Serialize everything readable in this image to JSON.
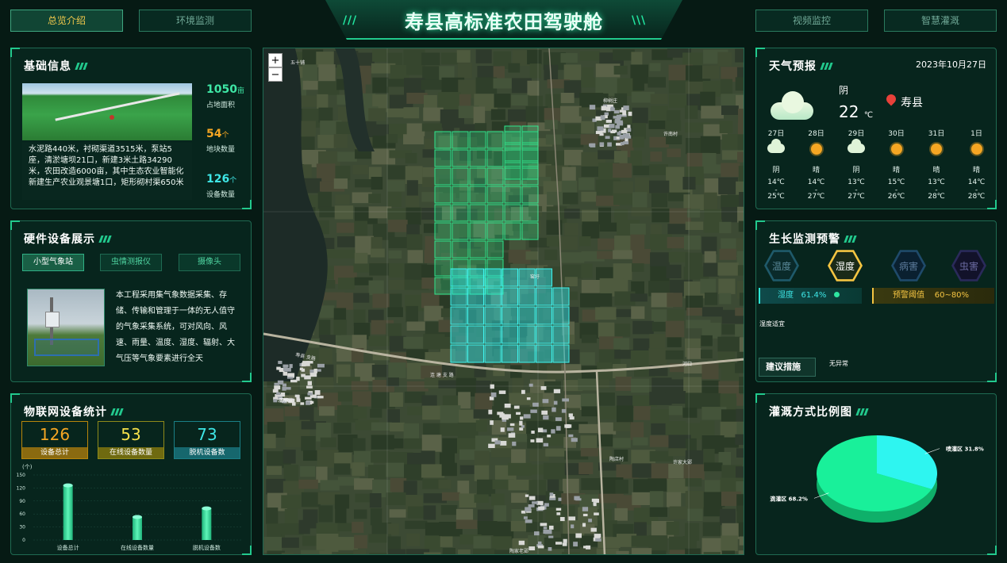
{
  "header": {
    "title": "寿县高标准农田驾驶舱",
    "nav_left": [
      "总览介绍",
      "环境监测"
    ],
    "nav_right": [
      "视频监控",
      "智慧灌溉"
    ],
    "active_nav": "总览介绍"
  },
  "basic_info": {
    "title": "基础信息",
    "description": "水泥路440米，衬砌渠道3515米，泵站5座，清淤塘坝21口，新建3米土路34290米，农田改造6000亩，其中生态农业智能化新建生产农业观景塘1口，矩形砌村渠650米",
    "stats": [
      {
        "value": "1050",
        "unit": "亩",
        "label": "占地面积",
        "color": "#3ee6a5"
      },
      {
        "value": "54",
        "unit": "个",
        "label": "地块数量",
        "color": "#f5a623"
      },
      {
        "value": "126",
        "unit": "个",
        "label": "设备数量",
        "color": "#3ee6e6"
      }
    ]
  },
  "hardware": {
    "title": "硬件设备展示",
    "tabs": [
      "小型气象站",
      "虫情测报仪",
      "摄像头"
    ],
    "active_tab": "小型气象站",
    "description": "本工程采用集气象数据采集、存储、传输和管理于一体的无人值守的气象采集系统，可对风向、风速、雨量、温度、湿度、辐射、大气压等气象要素进行全天"
  },
  "iot": {
    "title": "物联网设备统计",
    "kpis": [
      {
        "value": "126",
        "label": "设备总计",
        "color": "#f5a623",
        "bar": "#b8860b"
      },
      {
        "value": "53",
        "label": "在线设备数量",
        "color": "#f5e04a",
        "bar": "#8f8a1a"
      },
      {
        "value": "73",
        "label": "脱机设备数",
        "color": "#3ee6e6",
        "bar": "#1a7f86"
      }
    ]
  },
  "chart_data": [
    {
      "type": "bar",
      "ylabel": "(个)",
      "yticks": [
        "0",
        "30",
        "60",
        "90",
        "120",
        "150"
      ],
      "ylim": [
        0,
        150
      ],
      "categories": [
        "设备总计",
        "在线设备数量",
        "脱机设备数"
      ],
      "values": [
        126,
        53,
        73
      ]
    },
    {
      "type": "pie",
      "title": "灌溉方式比例图",
      "slices": [
        {
          "label": "喷灌区 31.8%",
          "value": 31.8,
          "color": "#2ef5f0"
        },
        {
          "label": "滴灌区 68.2%",
          "value": 68.2,
          "color": "#19f09a"
        }
      ]
    }
  ],
  "weather": {
    "title": "天气预报",
    "date": "2023年10月27日",
    "condition": "阴",
    "temp": "22",
    "temp_unit": "℃",
    "location": "寿县",
    "days": [
      {
        "day": "27日",
        "icon": "cloud",
        "cond": "阴",
        "low": "14℃",
        "dash": "-",
        "high": "25℃"
      },
      {
        "day": "28日",
        "icon": "sun",
        "cond": "晴",
        "low": "14℃",
        "dash": "-",
        "high": "27℃"
      },
      {
        "day": "29日",
        "icon": "cloud",
        "cond": "阴",
        "low": "13℃",
        "dash": "-",
        "high": "27℃"
      },
      {
        "day": "30日",
        "icon": "sun",
        "cond": "晴",
        "low": "15℃",
        "dash": "-",
        "high": "26℃"
      },
      {
        "day": "31日",
        "icon": "sun",
        "cond": "晴",
        "low": "13℃",
        "dash": "-",
        "high": "28℃"
      },
      {
        "day": "1日",
        "icon": "sun",
        "cond": "晴",
        "low": "14℃",
        "dash": "-",
        "high": "28℃"
      }
    ]
  },
  "growth": {
    "title": "生长监测预警",
    "hexes": [
      "温度",
      "湿度",
      "病害",
      "虫害"
    ],
    "active": "湿度",
    "humidity_label": "湿度",
    "humidity_value": "61.4%",
    "threshold_label": "预警阈值",
    "threshold_value": "60~80%",
    "status_text": "湿度适宜",
    "advice_label": "建议措施",
    "advice_value": "无异常"
  },
  "irrigation": {
    "title": "灌溉方式比例图"
  },
  "map": {
    "zoom_in": "+",
    "zoom_out": "−",
    "labels": [
      "五十铺",
      "柳树庄",
      "许南村",
      "窑圩",
      "河口",
      "曹家岗",
      "陶店村",
      "许家大郢",
      "陶家老郢",
      "袁家岗"
    ],
    "road_label_a": "寿县 支路",
    "road_label_b": "连 塘 支 路"
  }
}
